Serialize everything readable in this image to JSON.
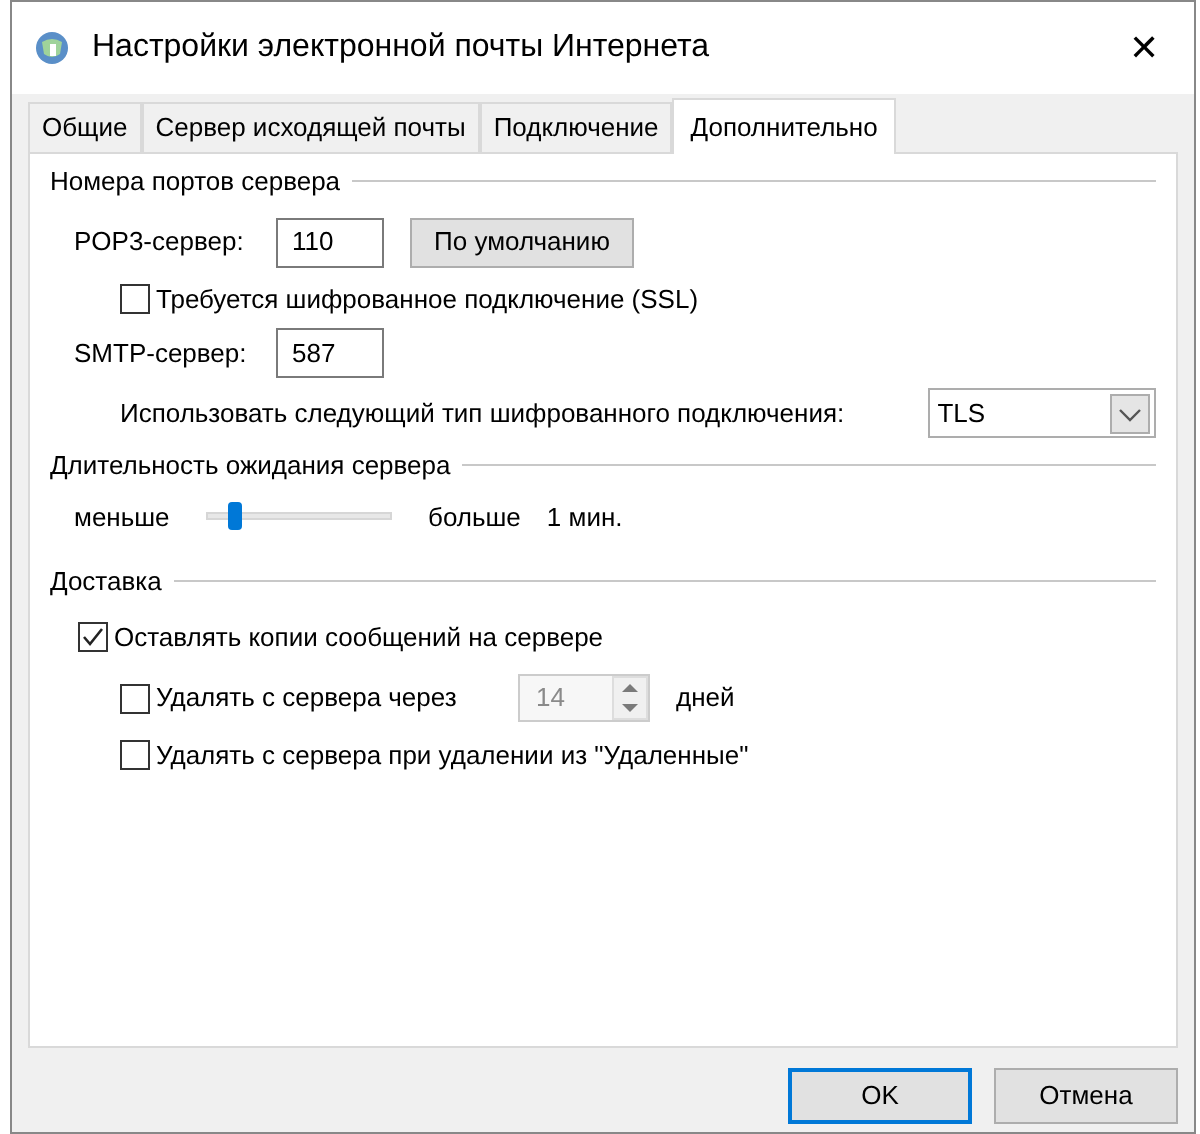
{
  "window": {
    "title": "Настройки электронной почты Интернета",
    "close": "✕"
  },
  "tabs": [
    {
      "label": "Общие",
      "selected": false
    },
    {
      "label": "Сервер исходящей почты",
      "selected": false
    },
    {
      "label": "Подключение",
      "selected": false
    },
    {
      "label": "Дополнительно",
      "selected": true
    }
  ],
  "ports": {
    "heading": "Номера портов сервера",
    "pop3_label": "POP3-сервер:",
    "pop3_value": "110",
    "default_button": "По умолчанию",
    "ssl": {
      "label": "Требуется шифрованное подключение (SSL)",
      "checked": false
    },
    "smtp_label": "SMTP-сервер:",
    "smtp_value": "587",
    "encryption_label": "Использовать следующий тип шифрованного подключения:",
    "encryption_value": "TLS"
  },
  "timeout": {
    "heading": "Длительность ожидания сервера",
    "min_label": "меньше",
    "max_label": "больше",
    "level": 0.13,
    "reading": "1 мин."
  },
  "delivery": {
    "heading": "Доставка",
    "leave_copies": {
      "label": "Оставлять копии сообщений на сервере",
      "checked": true
    },
    "remove_after": {
      "label": "Удалять с сервера через",
      "checked": false,
      "days": "14",
      "spinner_disabled": true,
      "unit": "дней"
    },
    "remove_deleted": {
      "label": "Удалять с сервера при удалении из \"Удаленные\"",
      "checked": false
    }
  },
  "buttons": [
    {
      "label": "OK",
      "kind": "default"
    },
    {
      "label": "Отмена",
      "kind": "normal"
    }
  ]
}
